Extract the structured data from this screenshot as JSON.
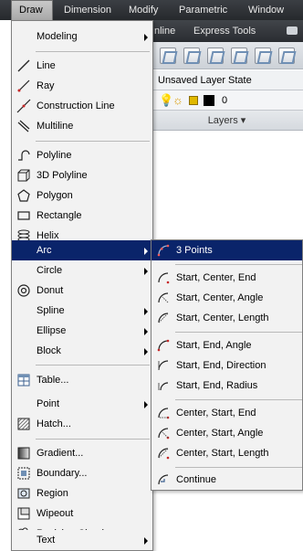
{
  "menubar": {
    "items": [
      {
        "label": "Draw",
        "active": true
      },
      {
        "label": "Dimension"
      },
      {
        "label": "Modify"
      },
      {
        "label": "Parametric"
      },
      {
        "label": "Window"
      }
    ]
  },
  "ribbon": {
    "tabs": [
      "nline",
      "Express Tools"
    ],
    "layer_state": "Unsaved Layer State",
    "layer_name": "0",
    "panel_title": "Layers"
  },
  "draw_menu": {
    "modeling": "Modeling",
    "line": "Line",
    "ray": "Ray",
    "construction_line": "Construction Line",
    "multiline": "Multiline",
    "polyline": "Polyline",
    "polyline_3d": "3D Polyline",
    "polygon": "Polygon",
    "rectangle": "Rectangle",
    "helix": "Helix",
    "arc": "Arc",
    "circle": "Circle",
    "donut": "Donut",
    "spline": "Spline",
    "ellipse": "Ellipse",
    "block": "Block",
    "table": "Table...",
    "point": "Point",
    "hatch": "Hatch...",
    "gradient": "Gradient...",
    "boundary": "Boundary...",
    "region": "Region",
    "wipeout": "Wipeout",
    "revision_cloud": "Revision Cloud",
    "text": "Text"
  },
  "arc_submenu": {
    "three_points": "3 Points",
    "start_center_end": "Start, Center, End",
    "start_center_angle": "Start, Center, Angle",
    "start_center_length": "Start, Center, Length",
    "start_end_angle": "Start, End, Angle",
    "start_end_direction": "Start, End, Direction",
    "start_end_radius": "Start, End, Radius",
    "center_start_end": "Center, Start, End",
    "center_start_angle": "Center, Start, Angle",
    "center_start_length": "Center, Start, Length",
    "continue": "Continue"
  },
  "colors": {
    "menubar": "#2f3236",
    "highlight": "#0a246a",
    "menu_bg": "#f2f2f2"
  }
}
